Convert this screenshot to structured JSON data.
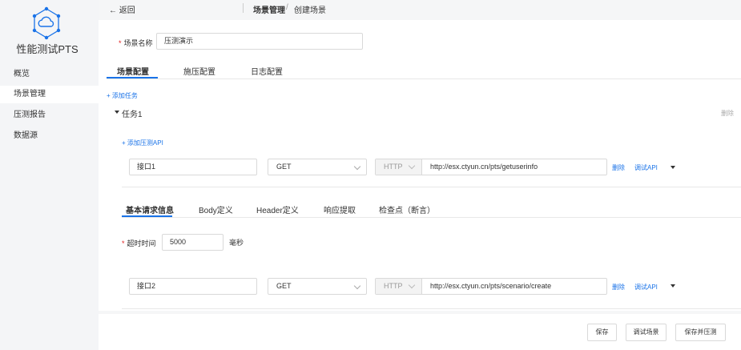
{
  "sidebar": {
    "app_title": "性能测试PTS",
    "items": [
      {
        "label": "概览"
      },
      {
        "label": "场景管理"
      },
      {
        "label": "压测报告"
      },
      {
        "label": "数据源"
      }
    ]
  },
  "topbar": {
    "back_label": "← 返回",
    "breadcrumb": [
      "场景管理",
      "/",
      "创建场景"
    ]
  },
  "scene": {
    "name_label": "场景名称",
    "name_value": "压测演示"
  },
  "main_tabs": [
    "场景配置",
    "施压配置",
    "日志配置"
  ],
  "add_task_label": "+ 添加任务",
  "task": {
    "title": "任务1",
    "delete_label": "删除",
    "add_api_label": "+ 添加压测API",
    "apis": [
      {
        "name": "接口1",
        "method": "GET",
        "protocol": "HTTP",
        "url": "http://esx.ctyun.cn/pts/getuserinfo",
        "delete_label": "删除",
        "debug_label": "调试API"
      },
      {
        "name": "接口2",
        "method": "GET",
        "protocol": "HTTP",
        "url": "http://esx.ctyun.cn/pts/scenario/create",
        "delete_label": "删除",
        "debug_label": "调试API"
      }
    ],
    "detail_tabs": [
      "基本请求信息",
      "Body定义",
      "Header定义",
      "响应提取",
      "检查点（断言）"
    ],
    "timeout_label": "超时时间",
    "timeout_value": "5000",
    "timeout_unit": "毫秒"
  },
  "footer": {
    "save_label": "保存",
    "debug_scene_label": "调试场景",
    "save_test_label": "保存并压测"
  },
  "colors": {
    "accent": "#1a73e8",
    "required": "#e02020"
  }
}
